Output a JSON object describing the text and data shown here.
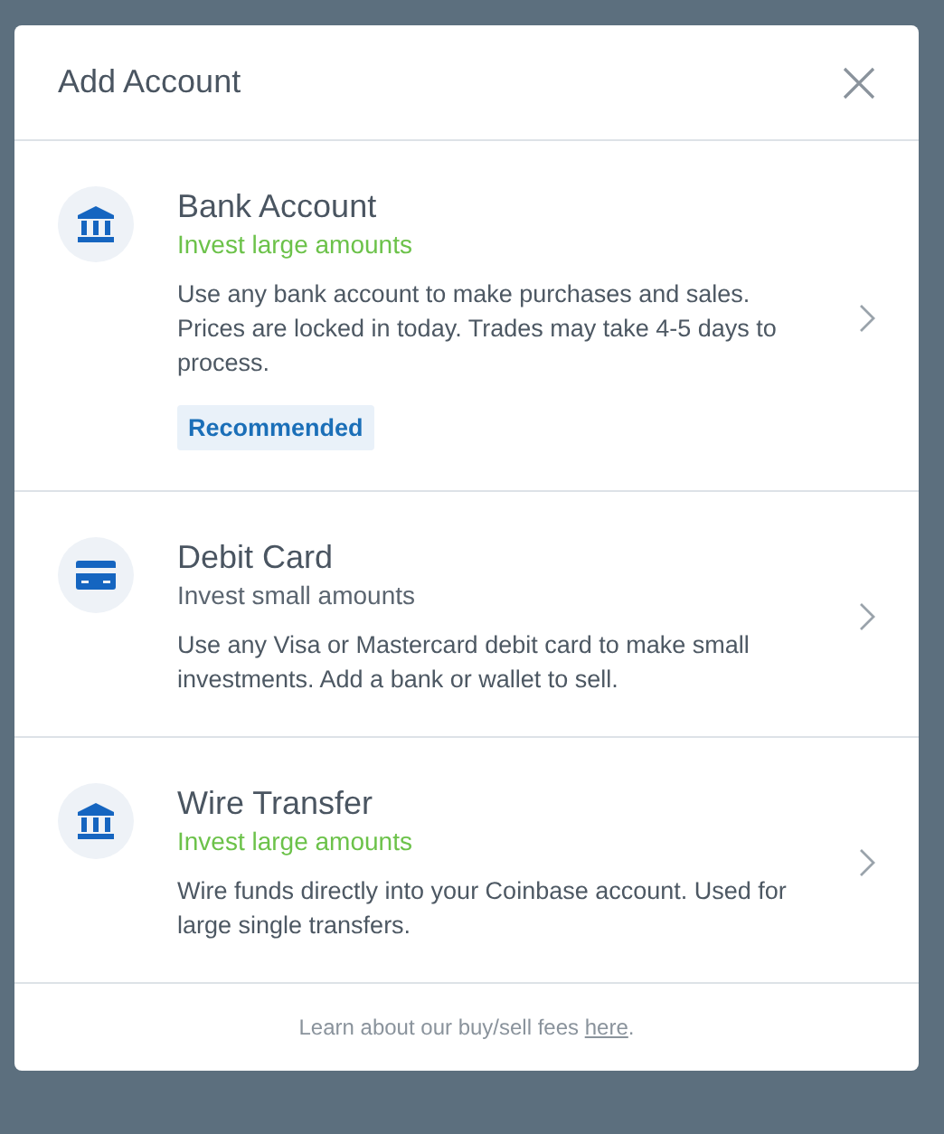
{
  "dialog": {
    "title": "Add Account"
  },
  "options": [
    {
      "kind": "bank",
      "title": "Bank Account",
      "subtitle": "Invest large amounts",
      "highlighted": true,
      "description": "Use any bank account to make purchases and sales. Prices are locked in today. Trades may take 4-5 days to process.",
      "badge": "Recommended"
    },
    {
      "kind": "card",
      "title": "Debit Card",
      "subtitle": "Invest small amounts",
      "highlighted": false,
      "description": "Use any Visa or Mastercard debit card to make small investments. Add a bank or wallet to sell."
    },
    {
      "kind": "bank",
      "title": "Wire Transfer",
      "subtitle": "Invest large amounts",
      "highlighted": true,
      "description": "Wire funds directly into your Coinbase account. Used for large single transfers."
    }
  ],
  "footer": {
    "text": "Learn about our buy/sell fees ",
    "link": "here",
    "after": "."
  }
}
